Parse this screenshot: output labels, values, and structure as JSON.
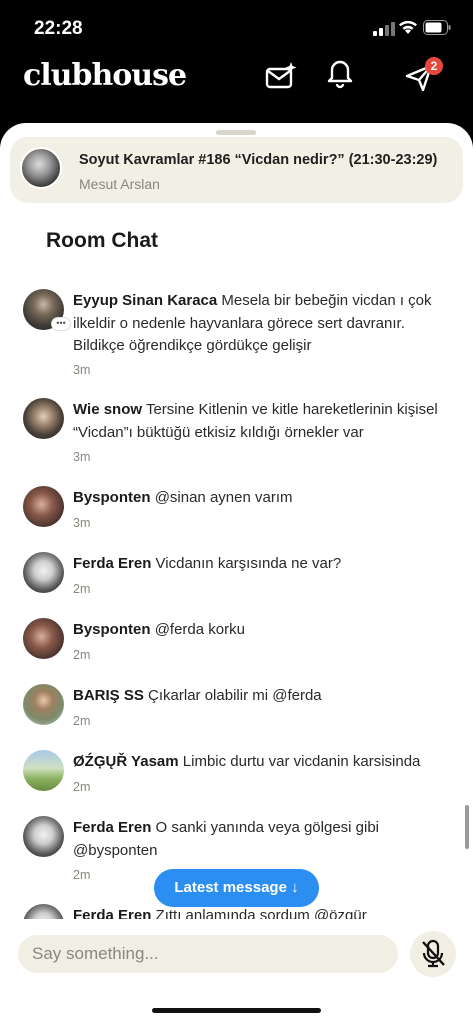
{
  "status": {
    "time": "22:28"
  },
  "app": {
    "logo": "clubhouse",
    "notification_count": "2"
  },
  "room": {
    "title": "Soyut Kavramlar #186 “Vicdan nedir?” (21:30-23:29)",
    "host": "Mesut Arslan"
  },
  "chat": {
    "heading": "Room Chat",
    "messages": [
      {
        "author": "Eyyup Sinan Karaca",
        "text": "Mesela bir bebeğin vicdan ı çok ilkeldir o nedenle hayvanlara görece sert davranır. Bildikçe öğrendikçe gördükçe gelişir",
        "time": "3m"
      },
      {
        "author": "Wie snow",
        "text": "Tersine Kitlenin ve kitle hareketlerinin kişisel “Vicdan”ı büktüğü etkisiz kıldığı örnekler var",
        "time": "3m"
      },
      {
        "author": "Bysponten",
        "text": "@sinan aynen varım",
        "time": "3m"
      },
      {
        "author": "Ferda Eren",
        "text": "Vicdanın karşısında ne var?",
        "time": "2m"
      },
      {
        "author": "Bysponten",
        "text": "@ferda korku",
        "time": "2m"
      },
      {
        "author": "BARIŞ SS",
        "text": "Çıkarlar olabilir mi @ferda",
        "time": "2m"
      },
      {
        "author": "ØŹĢŲŘ Yasam",
        "text": "Limbic durtu var vicdanin karsisinda",
        "time": "2m"
      },
      {
        "author": "Ferda Eren",
        "text": "O sanki yanında veya gölgesi gibi @bysponten",
        "time": "2m"
      },
      {
        "author": "Ferda Eren",
        "text": "Zıttı anlamında sordum @özgür",
        "time": ""
      }
    ],
    "latest_button": "Latest message ↓"
  },
  "composer": {
    "placeholder": "Say something..."
  },
  "icons": [
    "signal-icon",
    "wifi-icon",
    "battery-icon",
    "mail-sparkle-icon",
    "bell-icon",
    "paper-plane-icon",
    "more-icon",
    "mic-off-icon"
  ],
  "colors": {
    "accent": "#2b8ef0",
    "badge": "#e8473b",
    "sheet_bg": "#ffffff",
    "header_bg": "#000000"
  }
}
